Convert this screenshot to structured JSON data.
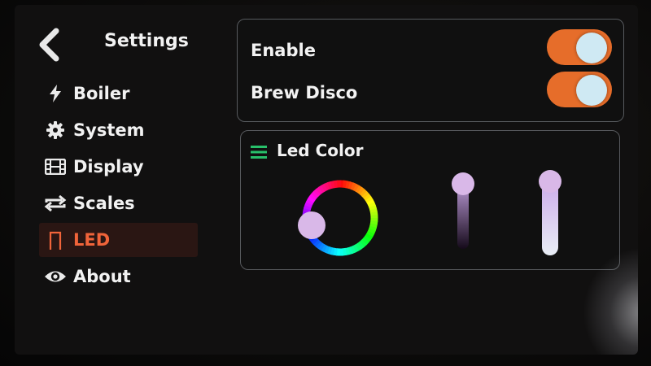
{
  "header": {
    "title": "Settings",
    "back_icon": "chevron-left-icon"
  },
  "menu": {
    "items": [
      {
        "label": "Boiler",
        "icon": "bolt-icon"
      },
      {
        "label": "System",
        "icon": "gear-icon"
      },
      {
        "label": "Display",
        "icon": "film-icon"
      },
      {
        "label": "Scales",
        "icon": "repeat-icon"
      },
      {
        "label": "LED",
        "icon": "led-icon",
        "active": true
      },
      {
        "label": "About",
        "icon": "eye-icon"
      }
    ]
  },
  "toggles": {
    "enable": {
      "label": "Enable",
      "on": true
    },
    "brew_disco": {
      "label": "Brew Disco",
      "on": true
    }
  },
  "led_color": {
    "title": "Led Color",
    "hue_level": 0.49,
    "slider1_level": 1.0,
    "slider2_level": 1.0
  },
  "colors": {
    "accent": "#f0643a",
    "toggle_on": "#e66d2a",
    "knob": "#cfe9f3",
    "slider_knob": "#d9b8e8",
    "hamburger": "#28c06a"
  }
}
